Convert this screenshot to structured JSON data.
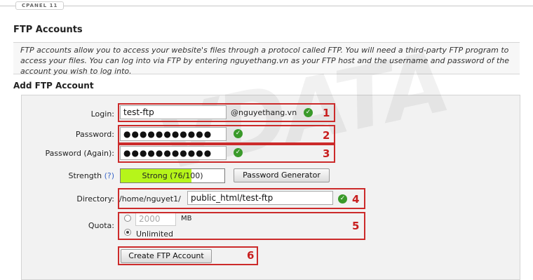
{
  "brand_tag": "CPANEL 11",
  "title": "FTP Accounts",
  "description": "FTP accounts allow you to access your website's files through a protocol called FTP. You will need a third-party FTP program to access your files. You can log into via FTP by entering nguyethang.vn as your FTP host and the username and password of the account you wish to log into.",
  "add_title": "Add FTP Account",
  "watermark": "VDATA",
  "form": {
    "login_label": "Login:",
    "login_value": "test-ftp",
    "domain_suffix": "@nguyethang.vn",
    "password_label": "Password:",
    "password_mask": "●●●●●●●●●●●",
    "password_again_label": "Password (Again):",
    "password_again_mask": "●●●●●●●●●●●",
    "strength_label": "Strength",
    "strength_help": "(?)",
    "strength_value": "Strong (76/100)",
    "strength_fraction": 0.68,
    "password_generator_label": "Password Generator",
    "directory_label": "Directory:",
    "directory_prefix": "/home/nguyet1/",
    "directory_value": "public_html/test-ftp",
    "quota_label": "Quota:",
    "quota_value": "2000",
    "quota_unit": "MB",
    "unlimited_label": "Unlimited",
    "create_button": "Create FTP Account"
  },
  "annotations": [
    "1",
    "2",
    "3",
    "4",
    "5",
    "6"
  ],
  "colors": {
    "annotation_red": "#cc2b2b",
    "ok_green": "#3a9a2a",
    "strength_green": "#b6f51a"
  }
}
